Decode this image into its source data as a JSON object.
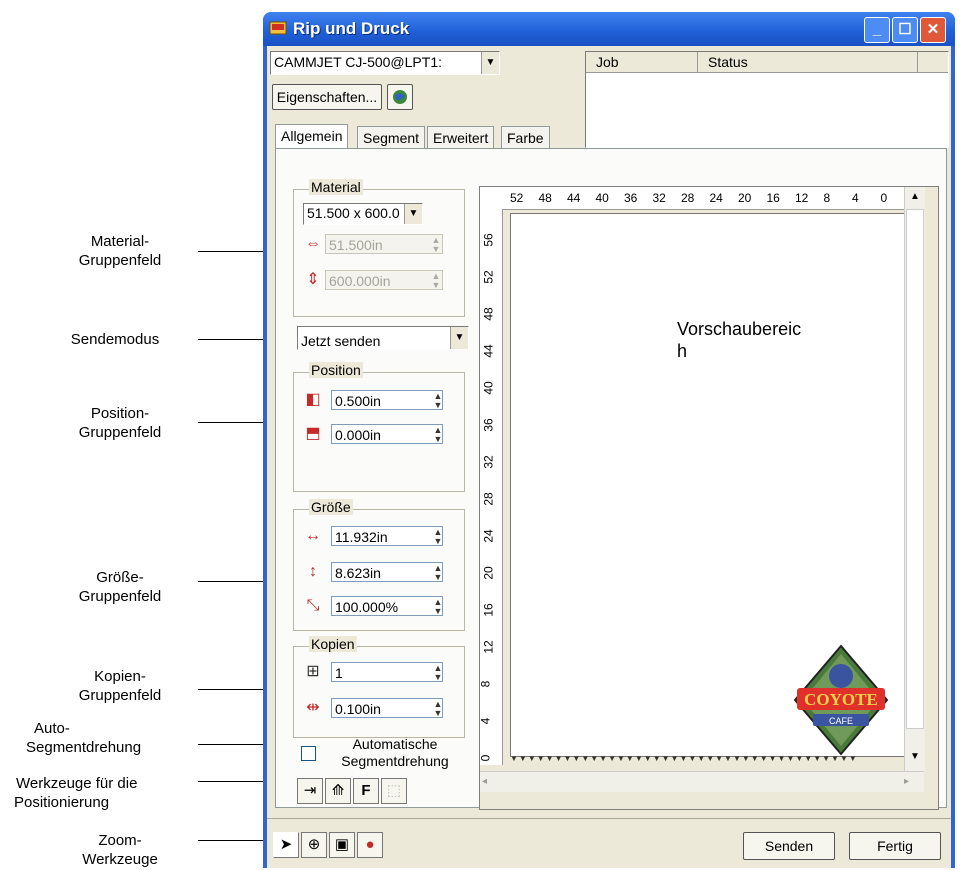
{
  "window": {
    "title": "Rip und Druck",
    "printer_select": "CAMMJET CJ-500@LPT1:",
    "properties_button": "Eigenschaften...",
    "job_table_headers": [
      "Job",
      "Status"
    ]
  },
  "tabs": [
    "Allgemein",
    "Segment",
    "Erweitert",
    "Farbe"
  ],
  "material": {
    "group_label": "Material",
    "size_select": "51.500 x 600.0",
    "width": "51.500in",
    "length": "600.000in"
  },
  "send_mode": {
    "value": "Jetzt senden"
  },
  "position": {
    "group_label": "Position",
    "left": "0.500in",
    "top": "0.000in"
  },
  "size": {
    "group_label": "Größe",
    "width": "11.932in",
    "height": "8.623in",
    "scale": "100.000%"
  },
  "copies": {
    "group_label": "Kopien",
    "count": "1",
    "spacing": "0.100in"
  },
  "auto_rotate": {
    "label": "Automatische Segmentdrehung",
    "checked": false
  },
  "positioning_tools": {
    "f_label": "F"
  },
  "preview": {
    "label": "Vorschaubereich",
    "top_ruler": [
      "52",
      "48",
      "44",
      "40",
      "36",
      "32",
      "28",
      "24",
      "20",
      "16",
      "12",
      "8",
      "4",
      "0"
    ],
    "side_ruler": [
      "56",
      "52",
      "48",
      "44",
      "40",
      "36",
      "32",
      "28",
      "24",
      "20",
      "16",
      "12",
      "8",
      "4",
      "0"
    ],
    "logo_text_main": "COYOTE",
    "logo_text_sub": "CAFE"
  },
  "footer": {
    "send_button": "Senden",
    "done_button": "Fertig"
  },
  "callouts": {
    "material_group": [
      "Material-",
      "Gruppenfeld"
    ],
    "send_mode": "Sendemodus",
    "position_group": [
      "Position-",
      "Gruppenfeld"
    ],
    "size_group": [
      "Größe-",
      "Gruppenfeld"
    ],
    "copies_group": [
      "Kopien-",
      "Gruppenfeld"
    ],
    "auto_rotate": [
      "Auto-",
      "Segmentdrehung"
    ],
    "positioning_tools": [
      "Werkzeuge für die",
      "Positionierung"
    ],
    "zoom_tools": [
      "Zoom-",
      "Werkzeuge"
    ]
  },
  "colors": {
    "titlebar": "#1f5fd6",
    "dialog_bg": "#ece9d8",
    "accent_red": "#c42a2a"
  }
}
